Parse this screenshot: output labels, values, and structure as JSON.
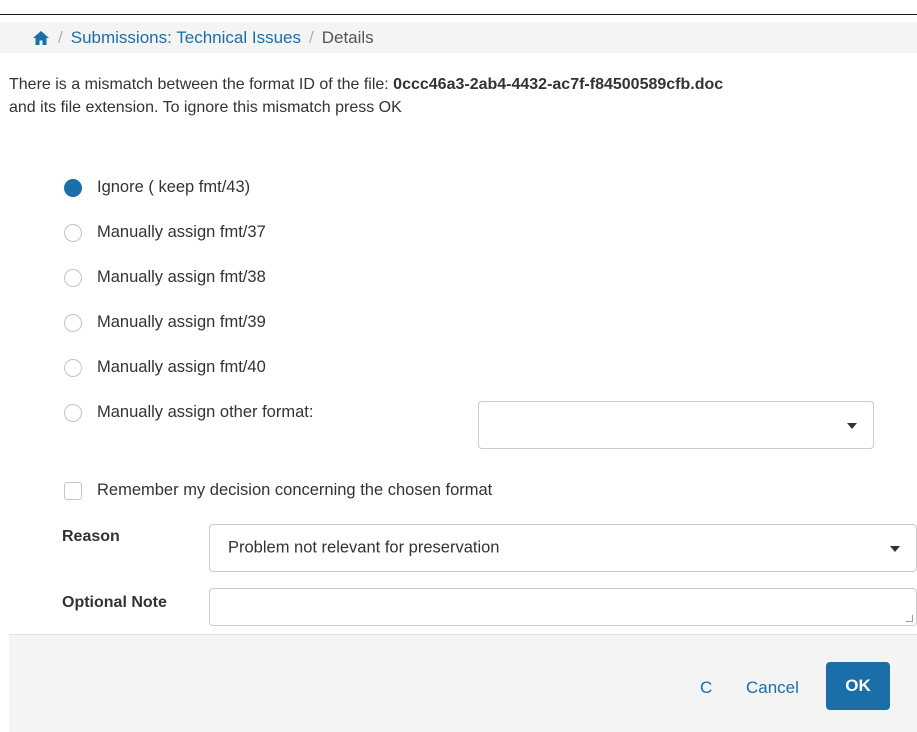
{
  "breadcrumb": {
    "home_icon": "home-icon",
    "separator": "/",
    "link": "Submissions: Technical Issues",
    "current": "Details"
  },
  "message": {
    "line1_prefix": "There is a mismatch between the format ID of the file: ",
    "file_name": "0ccc46a3-2ab4-4432-ac7f-f84500589cfb.doc",
    "line2": "and its file extension. To ignore this mismatch press OK"
  },
  "options": [
    {
      "label": "Ignore ( keep fmt/43)",
      "checked": true
    },
    {
      "label": "Manually assign fmt/37",
      "checked": false
    },
    {
      "label": "Manually assign fmt/38",
      "checked": false
    },
    {
      "label": "Manually assign fmt/39",
      "checked": false
    },
    {
      "label": "Manually assign fmt/40",
      "checked": false
    },
    {
      "label": "Manually assign other format:",
      "checked": false
    }
  ],
  "other_format_select": {
    "value": ""
  },
  "remember": {
    "label": "Remember my decision concerning the chosen format",
    "checked": false
  },
  "reason": {
    "label": "Reason",
    "value": "Problem not relevant for preservation"
  },
  "note": {
    "label": "Optional Note",
    "value": ""
  },
  "footer": {
    "c_link": "C",
    "cancel_label": "Cancel",
    "ok_label": "OK"
  },
  "colors": {
    "accent": "#1a6fa8",
    "panel": "#f4f4f4"
  }
}
